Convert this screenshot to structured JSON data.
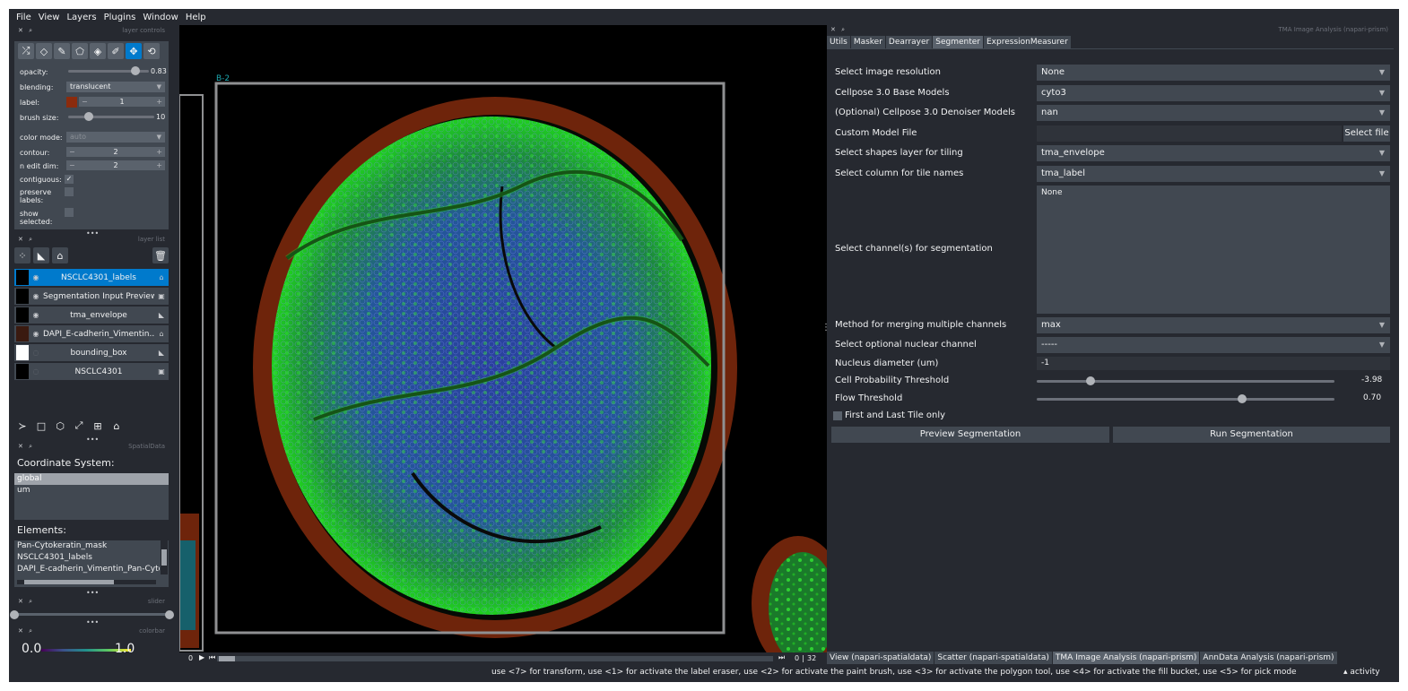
{
  "menu": [
    "File",
    "View",
    "Layers",
    "Plugins",
    "Window",
    "Help"
  ],
  "layer_controls": {
    "title": "layer controls",
    "tools": [
      "shuffle-icon",
      "eraser-icon",
      "brush-icon",
      "polygon-icon",
      "fill-icon",
      "picker-icon",
      "move-icon",
      "transform-icon"
    ],
    "opacity_label": "opacity:",
    "opacity_value": "0.83",
    "opacity_fraction": 0.83,
    "blending_label": "blending:",
    "blending_value": "translucent",
    "label_label": "label:",
    "label_value": "1",
    "label_color": "#8b2b0d",
    "brush_size_label": "brush size:",
    "brush_size_value": "10",
    "color_mode_label": "color mode:",
    "color_mode_value": "auto",
    "contour_label": "contour:",
    "contour_value": "2",
    "n_edit_dim_label": "n edit dim:",
    "n_edit_dim_value": "2",
    "contiguous_label": "contiguous:",
    "preserve_labels_label": "preserve\nlabels:",
    "show_selected_label": "show\nselected:"
  },
  "layer_list": {
    "title": "layer list",
    "layers": [
      {
        "name": "NSCLC4301_labels",
        "type_icon": "tag-icon",
        "visible": true,
        "selected": true
      },
      {
        "name": "Segmentation Input Preview",
        "type_icon": "image-icon",
        "visible": true,
        "selected": false
      },
      {
        "name": "tma_envelope",
        "type_icon": "shapes-icon",
        "visible": true,
        "selected": false
      },
      {
        "name": "DAPI_E-cadherin_Vimentin...",
        "type_icon": "tag-icon",
        "visible": true,
        "selected": false
      },
      {
        "name": "bounding_box",
        "type_icon": "shapes-icon",
        "visible": false,
        "selected": false
      },
      {
        "name": "NSCLC4301",
        "type_icon": "image-icon",
        "visible": false,
        "selected": false
      }
    ]
  },
  "spatialdata": {
    "title": "SpatialData",
    "coord_label": "Coordinate System:",
    "coord_systems": [
      "global",
      "um"
    ],
    "elements_label": "Elements:",
    "elements": [
      "Pan-Cytokeratin_mask",
      "NSCLC4301_labels",
      "DAPI_E-cadherin_Vimentin_Pan-Cytoke"
    ]
  },
  "slider": {
    "title": "slider"
  },
  "colorbar": {
    "title": "colorbar",
    "min": "0.0",
    "max": "1.0"
  },
  "canvas": {
    "tile_label": "B-2"
  },
  "dims": {
    "frame": "0",
    "total": "32"
  },
  "dock": {
    "title": "TMA Image Analysis (napari-prism)",
    "tabs": [
      "Utils",
      "Masker",
      "Dearrayer",
      "Segmenter",
      "ExpressionMeasurer"
    ],
    "active_tab": 3,
    "fields": {
      "resolution_label": "Select image resolution",
      "resolution_value": "None",
      "base_models_label": "Cellpose 3.0 Base Models",
      "base_models_value": "cyto3",
      "denoiser_label": "(Optional) Cellpose 3.0 Denoiser Models",
      "denoiser_value": "nan",
      "custom_model_label": "Custom Model File",
      "select_file_label": "Select file",
      "shapes_layer_label": "Select shapes layer for tiling",
      "shapes_layer_value": "tma_envelope",
      "tile_column_label": "Select column for tile names",
      "tile_column_value": "tma_label",
      "channels_label": "Select channel(s) for segmentation",
      "channels_value": "None",
      "merge_label": "Method for merging multiple channels",
      "merge_value": "max",
      "nuclear_label": "Select optional nuclear channel",
      "nuclear_value": "-----",
      "diameter_label": "Nucleus diameter (um)",
      "diameter_value": "-1",
      "cellprob_label": "Cell Probability Threshold",
      "cellprob_value": "-3.98",
      "cellprob_fraction": 0.18,
      "flow_label": "Flow Threshold",
      "flow_value": "0.70",
      "flow_fraction": 0.69,
      "first_last_label": "First and Last Tile only",
      "preview_button": "Preview Segmentation",
      "run_button": "Run Segmentation"
    }
  },
  "bottom_tabs": [
    "View (napari-spatialdata)",
    "Scatter (napari-spatialdata)",
    "TMA Image Analysis (napari-prism)",
    "AnnData Analysis (napari-prism)"
  ],
  "bottom_active": 2,
  "status": {
    "message": "use <7> for transform, use <1> for activate the label eraser, use <2> for activate the paint brush, use <3> for activate the polygon tool, use <4> for activate the fill bucket, use <5> for pick mode",
    "activity": "activity"
  },
  "colors": {
    "accent": "#007acc",
    "bg": "#262930",
    "panel": "#414851",
    "envelope": "#7a2a0c",
    "cells_green": "#2bd62b",
    "cells_blue": "#3a5ad0"
  }
}
